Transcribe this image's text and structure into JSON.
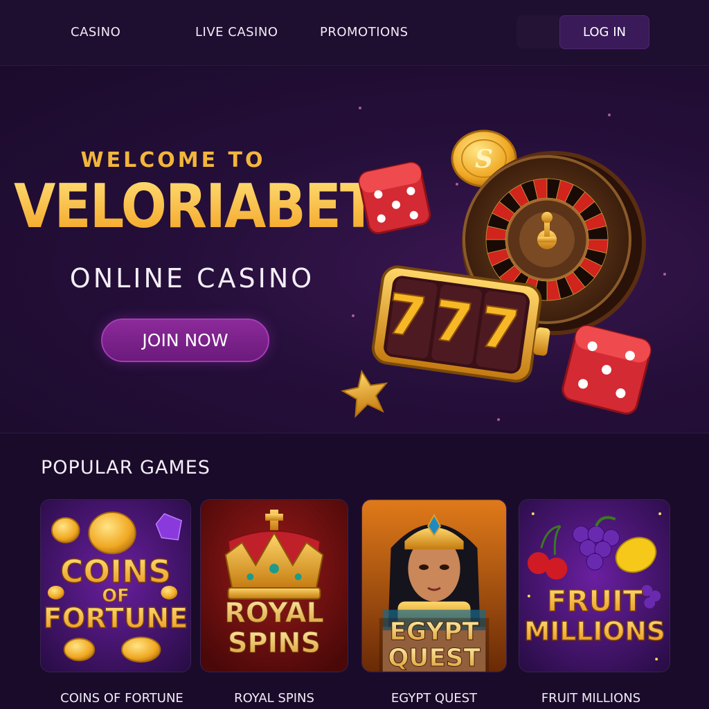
{
  "nav": {
    "items": [
      "CASINO",
      "LIVE CASINO",
      "PROMOTIONS"
    ],
    "login_label": "LOG IN"
  },
  "hero": {
    "welcome": "WELCOME TO",
    "brand": "VELORIABET",
    "tagline": "ONLINE CASINO",
    "cta": "JOIN NOW",
    "slot_symbols": "777",
    "coin_symbol": "S"
  },
  "popular": {
    "title": "POPULAR GAMES",
    "games": [
      {
        "name": "COINS OF FORTUNE",
        "art_line1": "COINS",
        "art_line2": "OF",
        "art_line3": "FORTUNE"
      },
      {
        "name": "ROYAL SPINS",
        "art_line1": "ROYAL",
        "art_line2": "SPINS"
      },
      {
        "name": "EGYPT QUEST",
        "art_line1": "EGYPT",
        "art_line2": "QUEST"
      },
      {
        "name": "FRUIT MILLIONS",
        "art_line1": "FRUIT",
        "art_line2": "MILLIONS"
      }
    ]
  },
  "colors": {
    "background": "#1a0b2a",
    "gold": "#f3b63a",
    "purple_button": "#7a2088"
  }
}
